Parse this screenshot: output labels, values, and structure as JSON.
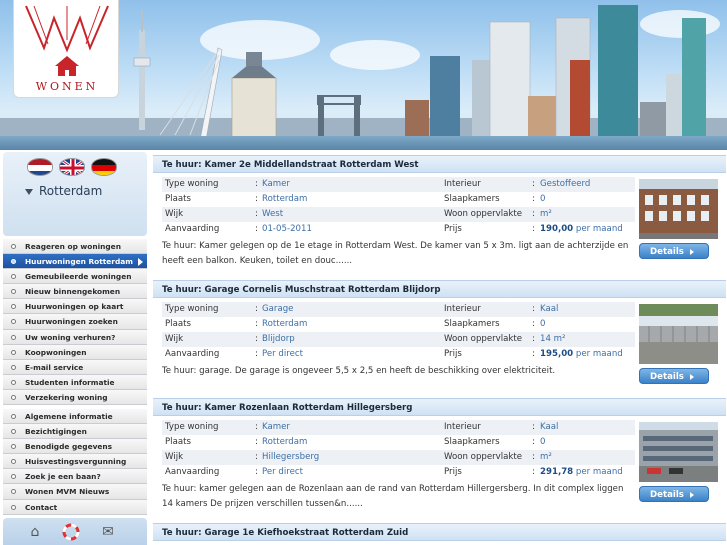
{
  "brand": {
    "logo_text": "WONEN"
  },
  "sidebar": {
    "languages": [
      {
        "name": "dutch-flag-icon"
      },
      {
        "name": "english-flag-icon"
      },
      {
        "name": "german-flag-icon"
      }
    ],
    "city": "Rotterdam",
    "menu_group_1": [
      {
        "label": "Reageren op woningen",
        "active": false
      },
      {
        "label": "Huurwoningen Rotterdam",
        "active": true
      },
      {
        "label": "Gemeubileerde woningen",
        "active": false
      },
      {
        "label": "Nieuw binnengekomen",
        "active": false
      },
      {
        "label": "Huurwoningen op kaart",
        "active": false
      },
      {
        "label": "Huurwoningen zoeken",
        "active": false
      },
      {
        "label": "Uw woning verhuren?",
        "active": false
      },
      {
        "label": "Koopwoningen",
        "active": false
      },
      {
        "label": "E-mail service",
        "active": false
      },
      {
        "label": "Studenten informatie",
        "active": false
      },
      {
        "label": "Verzekering woning",
        "active": false
      }
    ],
    "menu_group_2": [
      {
        "label": "Algemene informatie"
      },
      {
        "label": "Bezichtigingen"
      },
      {
        "label": "Benodigde gegevens"
      },
      {
        "label": "Huisvestingsvergunning"
      },
      {
        "label": "Zoek je een baan?"
      },
      {
        "label": "Wonen MVM Nieuws"
      },
      {
        "label": "Contact"
      }
    ],
    "bottom_icons": [
      "home-icon",
      "lifebuoy-icon",
      "envelope-icon"
    ]
  },
  "labels": {
    "type": "Type woning",
    "place": "Plaats",
    "district": "Wijk",
    "start": "Aanvaarding",
    "interior": "Interieur",
    "bedrooms": "Slaapkamers",
    "area": "Woon oppervlakte",
    "price": "Prijs",
    "sep": ":",
    "details": "Details"
  },
  "listings": [
    {
      "title": "Te huur: Kamer 2e Middellandstraat Rotterdam West",
      "type": "Kamer",
      "place": "Rotterdam",
      "district": "West",
      "start": "01-05-2011",
      "interior": "Gestoffeerd",
      "bedrooms": "0",
      "area_value": "",
      "area_unit": "m²",
      "price_amount": "190,00",
      "price_period": " per maand",
      "description": "Te huur: Kamer gelegen op de 1e etage in Rotterdam West. De kamer van 5 x 3m. ligt aan de achterzijde en heeft een balkon. Keuken, toilet en douc......"
    },
    {
      "title": "Te huur: Garage Cornelis Muschstraat Rotterdam Blijdorp",
      "type": "Garage",
      "place": "Rotterdam",
      "district": "Blijdorp",
      "start": "Per direct",
      "interior": "Kaal",
      "bedrooms": "0",
      "area_value": "14 ",
      "area_unit": "m²",
      "price_amount": "195,00",
      "price_period": " per maand",
      "description": "Te huur: garage. De garage is ongeveer 5,5 x 2,5 en heeft de beschikking over elektriciteit."
    },
    {
      "title": "Te huur: Kamer Rozenlaan Rotterdam Hillegersberg",
      "type": "Kamer",
      "place": "Rotterdam",
      "district": "Hillegersberg",
      "start": "Per direct",
      "interior": "Kaal",
      "bedrooms": "0",
      "area_value": "",
      "area_unit": "m²",
      "price_amount": "291,78",
      "price_period": " per maand",
      "description": "Te huur: kamer gelegen aan de Rozenlaan aan de rand van Rotterdam Hillergersberg. In dit complex liggen 14 kamers De prijzen verschillen tussen&n......"
    },
    {
      "title": "Te huur: Garage 1e Kiefhoekstraat Rotterdam Zuid"
    }
  ]
}
